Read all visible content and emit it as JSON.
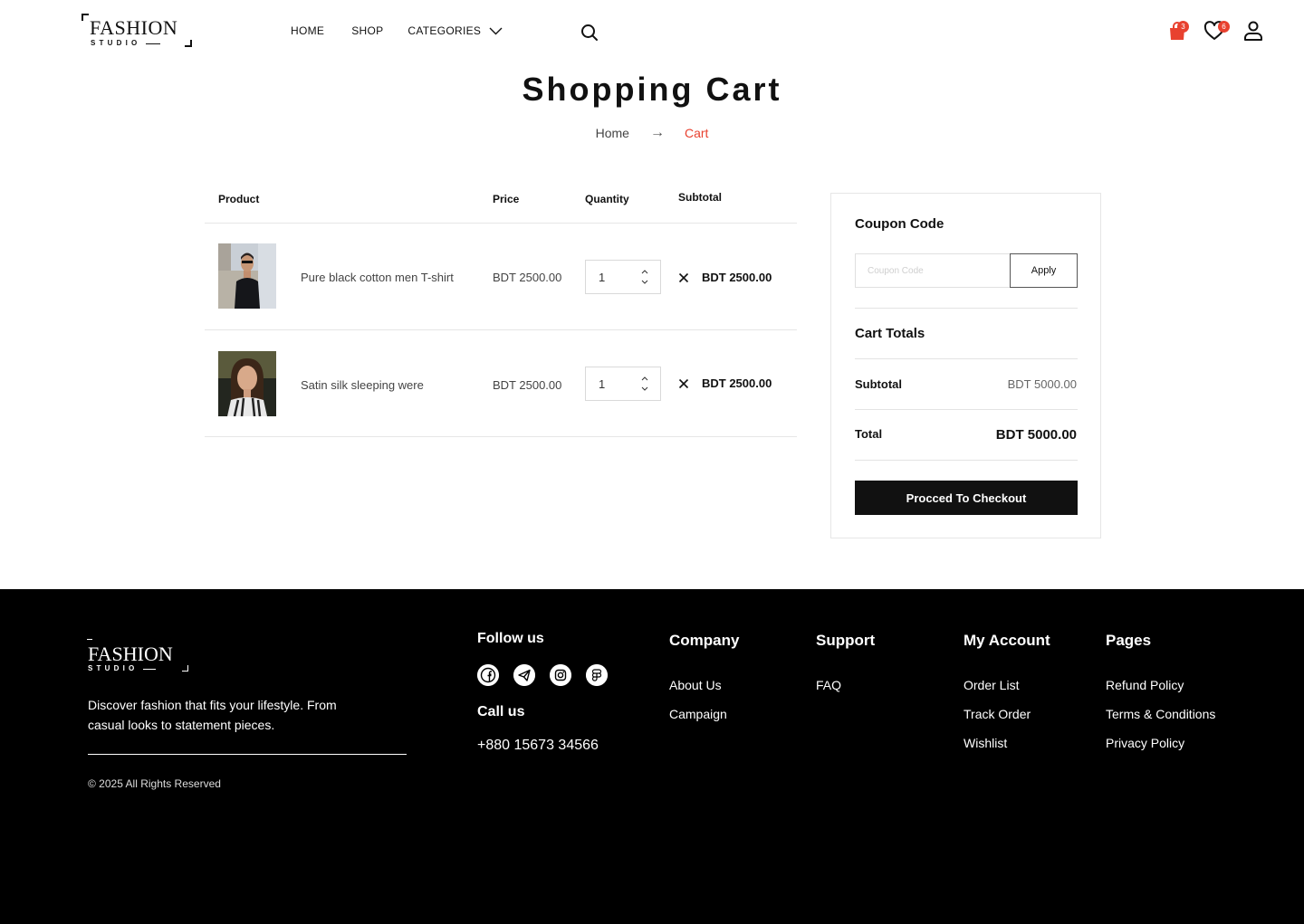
{
  "brand": {
    "name": "FASHION",
    "tagline": "STUDIO"
  },
  "nav": {
    "home": "HOME",
    "shop": "SHOP",
    "categories": "CATEGORIES"
  },
  "header": {
    "cart_count": "3",
    "wishlist_count": "6"
  },
  "page": {
    "title": "Shopping Cart"
  },
  "breadcrumb": {
    "home": "Home",
    "arrow": "→",
    "current": "Cart"
  },
  "cart": {
    "columns": {
      "product": "Product",
      "price": "Price",
      "quantity": "Quantity",
      "subtotal": "Subtotal"
    },
    "items": [
      {
        "name": "Pure black cotton men T-shirt",
        "price": "BDT 2500.00",
        "qty": "1",
        "subtotal": "BDT 2500.00"
      },
      {
        "name": "Satin silk sleeping were",
        "price": "BDT 2500.00",
        "qty": "1",
        "subtotal": "BDT 2500.00"
      }
    ]
  },
  "summary": {
    "coupon_title": "Coupon Code",
    "coupon_placeholder": "Coupon Code",
    "apply_label": "Apply",
    "totals_title": "Cart Totals",
    "subtotal_label": "Subtotal",
    "subtotal_value": "BDT 5000.00",
    "total_label": "Total",
    "total_value": "BDT 5000.00",
    "checkout_label": "Procced To Checkout"
  },
  "footer": {
    "description": "Discover fashion that fits your lifestyle. From casual looks to statement pieces.",
    "copyright": "© 2025 All Rights Reserved",
    "follow_title": "Follow us",
    "call_title": "Call us",
    "phone": "+880 15673 34566",
    "company": {
      "title": "Company",
      "links": [
        "About Us",
        "Campaign"
      ]
    },
    "support": {
      "title": "Support",
      "links": [
        "FAQ"
      ]
    },
    "account": {
      "title": "My Account",
      "links": [
        "Order List",
        "Track Order",
        "Wishlist"
      ]
    },
    "pages": {
      "title": "Pages",
      "links": [
        "Refund Policy",
        "Terms & Conditions",
        "Privacy Policy"
      ]
    }
  },
  "colors": {
    "accent": "#e8412f",
    "dark": "#111111",
    "footer_bg": "#000000"
  },
  "icons": [
    "search-icon",
    "shopping-bag-icon",
    "heart-icon",
    "user-icon",
    "chevron-down-icon",
    "close-icon",
    "facebook-icon",
    "telegram-icon",
    "instagram-icon",
    "figma-icon"
  ]
}
